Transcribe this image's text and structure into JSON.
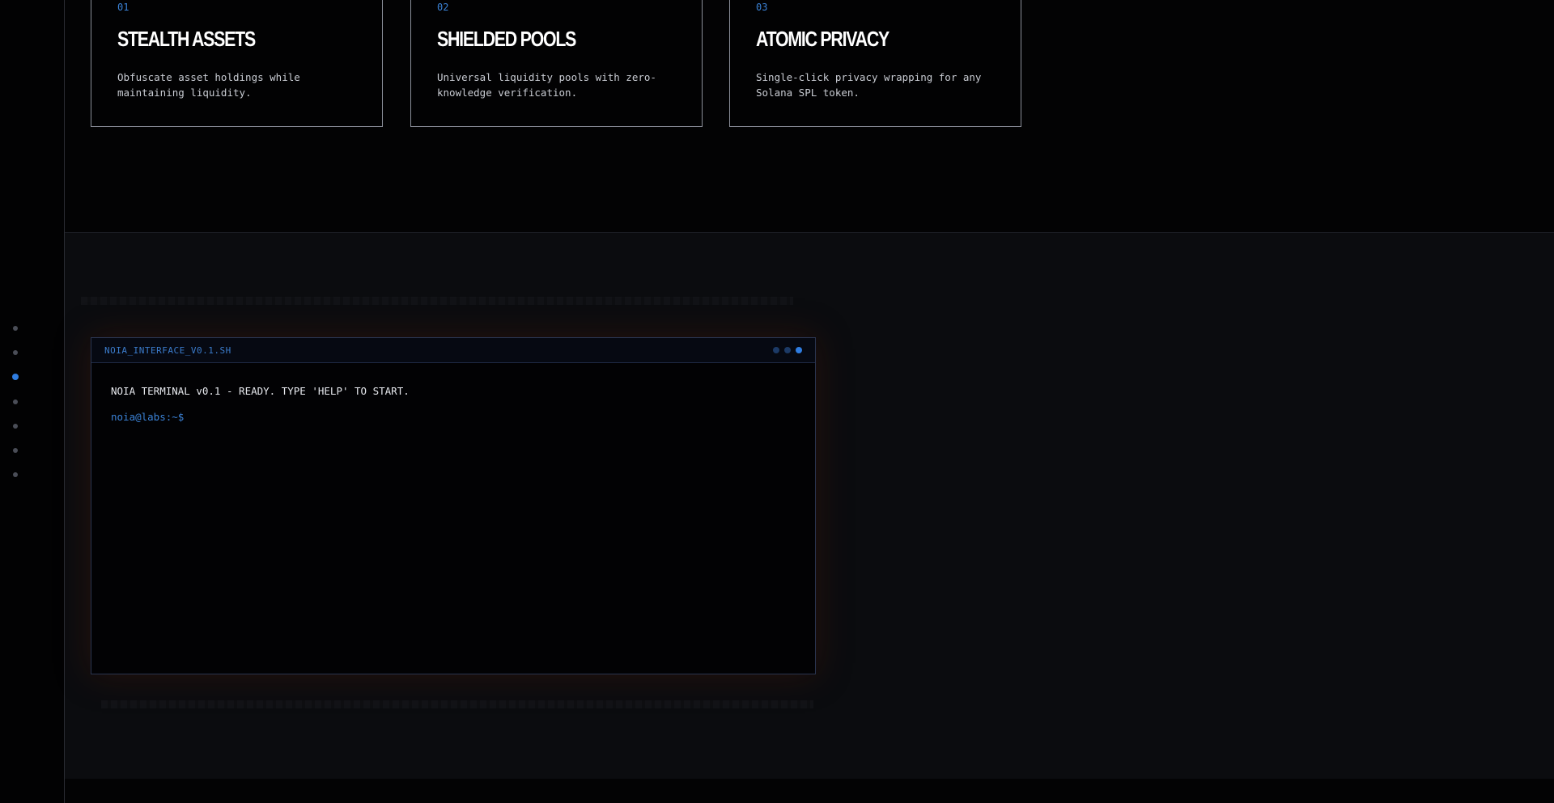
{
  "features": {
    "cards": [
      {
        "number": "01",
        "title": "STEALTH ASSETS",
        "description": "Obfuscate asset holdings while maintaining liquidity."
      },
      {
        "number": "02",
        "title": "SHIELDED POOLS",
        "description": "Universal liquidity pools with zero-knowledge verification."
      },
      {
        "number": "03",
        "title": "ATOMIC PRIVACY",
        "description": "Single-click privacy wrapping for any Solana SPL token."
      }
    ]
  },
  "side_nav": {
    "dot_count": 7,
    "active_index": 2
  },
  "terminal": {
    "title": "NOIA_INTERFACE_V0.1.SH",
    "ready_message": "NOIA TERMINAL v0.1 - READY. TYPE 'HELP' TO START.",
    "prompt": "noia@labs:~$",
    "input_value": ""
  },
  "colors": {
    "accent": "#3b82d6",
    "active_dot": "#2f7de1",
    "background": "#040405",
    "card_border": "#8a8e99"
  }
}
